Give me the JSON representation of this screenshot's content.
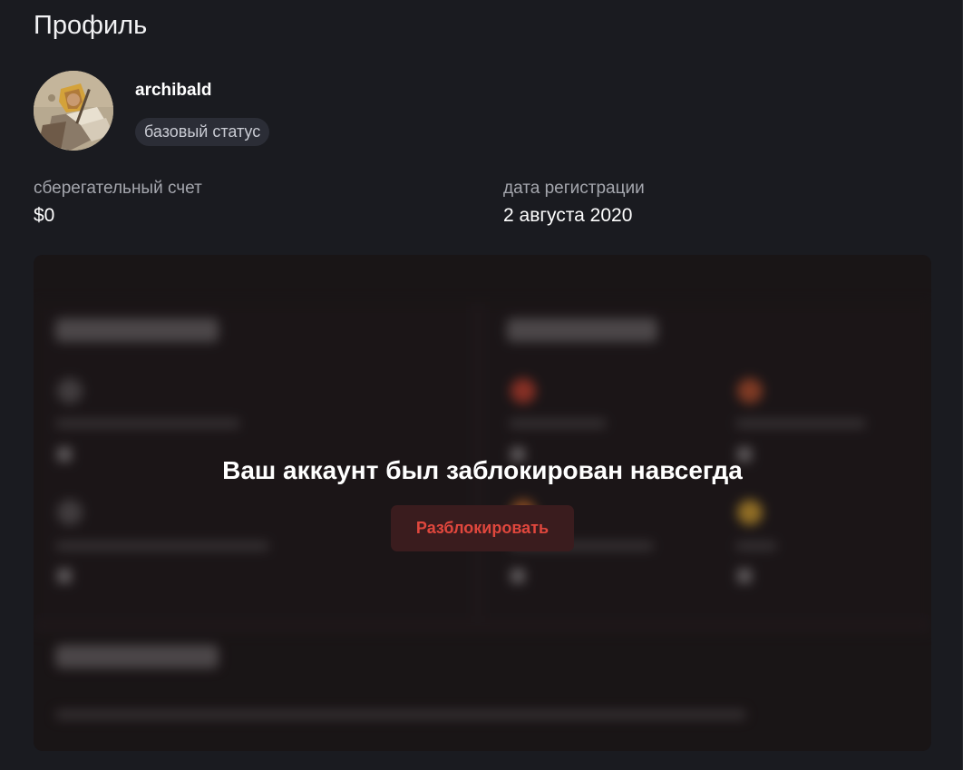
{
  "page": {
    "title": "Профиль"
  },
  "profile": {
    "avatar_icon": "mosaic-portrait-avatar",
    "username": "archibald",
    "status": "базовый статус"
  },
  "info": {
    "savings_label": "сберегательный счет",
    "savings_value": "$0",
    "registration_label": "дата регистрации",
    "registration_value": "2 августа 2020"
  },
  "blocked": {
    "message": "Ваш аккаунт был заблокирован навсегда",
    "unblock_label": "Разблокировать"
  },
  "colors": {
    "background": "#1a1b20",
    "panel": "#1d1719",
    "accent_red": "#e0473d",
    "button_bg": "#3a1c1e",
    "badge_bg": "#2b2d36"
  }
}
